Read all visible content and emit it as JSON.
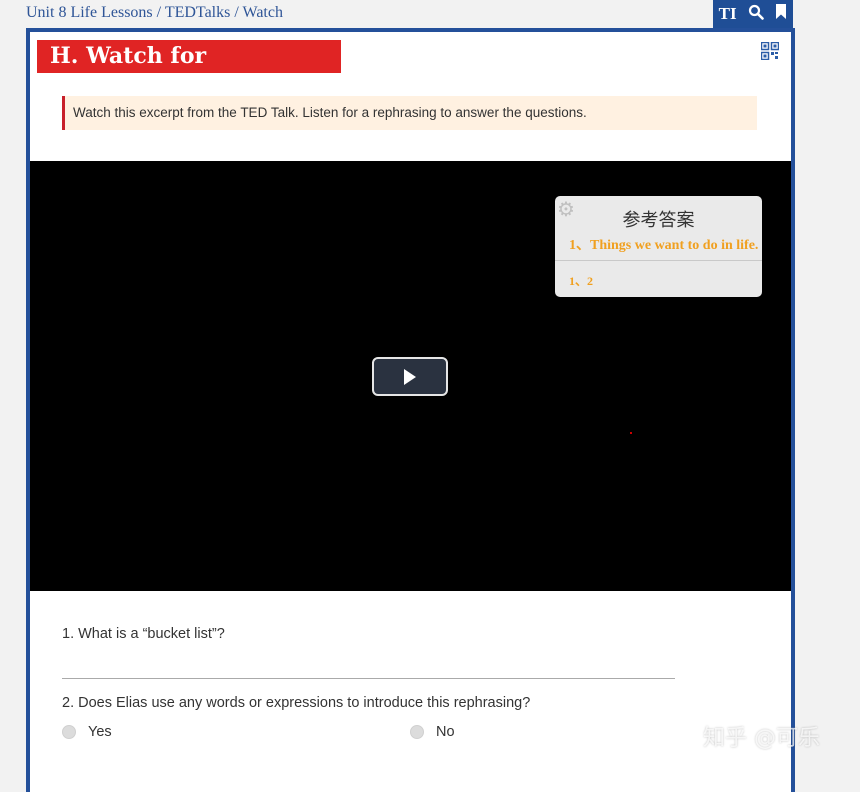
{
  "breadcrumb": {
    "items": [
      "Unit 8 Life Lessons",
      "TEDTalks",
      "Watch"
    ],
    "separator": " / "
  },
  "toolbar": {
    "text_size_label": "TI",
    "icons": [
      "text-size-icon",
      "search-icon",
      "bookmark-icon"
    ]
  },
  "section": {
    "title": "H. Watch for Rephrasing",
    "instruction": "Watch this excerpt from the TED Talk. Listen for a rephrasing to answer the questions."
  },
  "video": {
    "answer_panel": {
      "title": "参考答案",
      "answer1": "1、Things we want to do in life.",
      "answer2": "1、2"
    }
  },
  "questions": {
    "q1": "1. What is a “bucket list”?",
    "q2": "2. Does Elias use any words or expressions to introduce this rephrasing?",
    "options": [
      "Yes",
      "No"
    ]
  },
  "watermark": "知乎 @可乐",
  "colors": {
    "header_blue": "#1f4e96",
    "title_red": "#e02424",
    "answer_orange": "#f0a020"
  }
}
